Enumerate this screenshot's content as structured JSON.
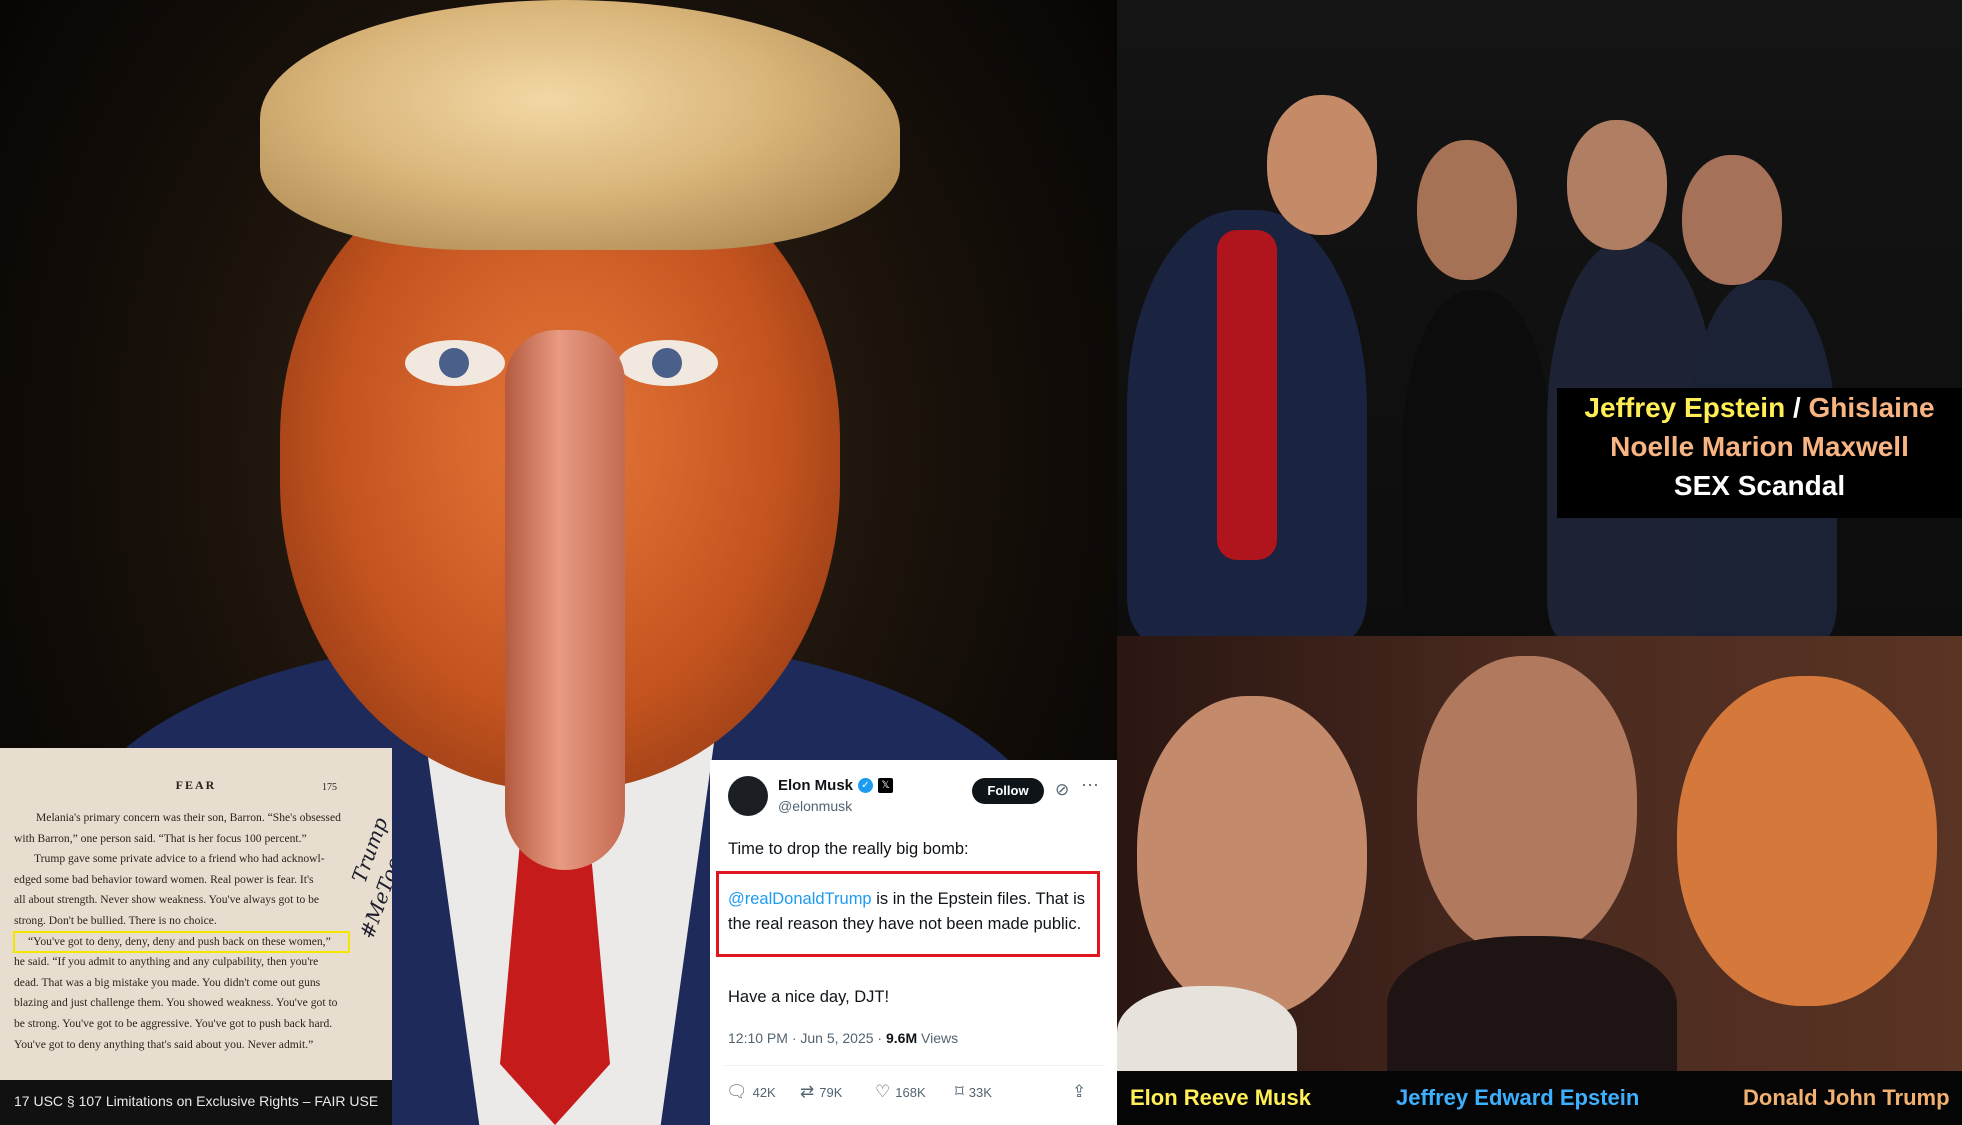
{
  "book": {
    "header": "FEAR",
    "page_number": "175",
    "lines": [
      "Melania's primary concern was their son, Barron. “She's obsessed",
      "with Barron,” one person said. “That is her focus 100 percent.”",
      "Trump gave some private advice to a friend who had acknowl-",
      "edged some bad behavior toward women. Real power is fear. It's",
      "all about strength. Never show weakness. You've always got to be",
      "strong. Don't be bullied. There is no choice.",
      "“You've got to deny, deny, deny and push back on these women,”",
      "he said. “If you admit to anything and any culpability, then you're",
      "dead. That was a big mistake you made. You didn't come out guns",
      "blazing and just challenge them. You showed weakness. You've got to",
      "be strong. You've got to be aggressive. You've got to push back hard.",
      "You've got to deny anything that's said about you. Never admit.”"
    ],
    "annotation_1": "Trump",
    "annotation_2": "#MeToo"
  },
  "caption": "17 USC § 107 Limitations on Exclusive Rights – FAIR USE",
  "tweet": {
    "name": "Elon Musk",
    "handle": "@elonmusk",
    "follow_label": "Follow",
    "line1": "Time to drop the really big bomb:",
    "mention": "@realDonaldTrump",
    "body_rest": " is in the Epstein files. That is the real reason they have not been made public.",
    "line2": "Have a nice day, DJT!",
    "timestamp": "12:10 PM · Jun 5, 2025 · ",
    "views_count": "9.6M",
    "views_label": " Views",
    "replies": "42K",
    "reposts": "79K",
    "likes": "168K",
    "bookmarks": "33K"
  },
  "overlay": {
    "name1": "Jeffrey Epstein",
    "separator": " / ",
    "name2a": "Ghislaine",
    "name2b": "Noelle Marion Maxwell",
    "line3": "SEX Scandal"
  },
  "bottom_names": {
    "left": "Elon Reeve Musk",
    "middle": "Jeffrey Edward Epstein",
    "right": "Donald John Trump"
  },
  "colors": {
    "highlight_yellow": "#f4e600",
    "tweet_red_box": "#e0161e",
    "mention_blue": "#1d9bf0",
    "overlay_yellow": "#ffee55",
    "overlay_peach": "#f8b482",
    "name_blue": "#3cb0ff",
    "name_orange": "#f2b171"
  }
}
